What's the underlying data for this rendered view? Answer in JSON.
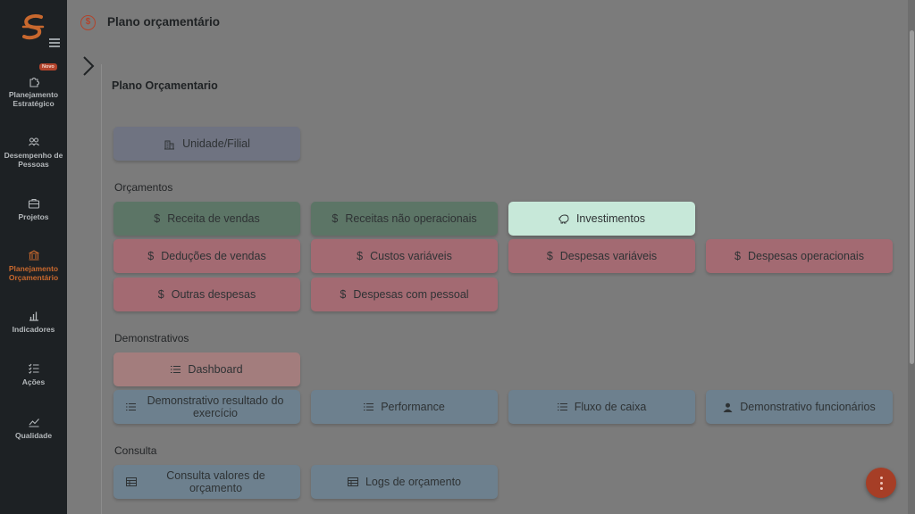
{
  "sidebar": {
    "badge": "Novo",
    "items": [
      {
        "label": "Planejamento Estratégico",
        "icon": "puzzle-icon"
      },
      {
        "label": "Desempenho de Pessoas",
        "icon": "people-icon"
      },
      {
        "label": "Projetos",
        "icon": "briefcase-icon"
      },
      {
        "label": "Planejamento Orçamentário",
        "icon": "bank-icon",
        "active": true
      },
      {
        "label": "Indicadores",
        "icon": "bar-chart-icon"
      },
      {
        "label": "Ações",
        "icon": "checklist-icon"
      },
      {
        "label": "Qualidade",
        "icon": "line-chart-icon"
      }
    ]
  },
  "header": {
    "title": "Plano orçamentário"
  },
  "main": {
    "title": "Plano Orçamentario",
    "unit_button": "Unidade/Filial",
    "groups": {
      "orcamentos": "Orçamentos",
      "demonstrativos": "Demonstrativos",
      "consulta": "Consulta"
    },
    "orcamentos": [
      "Receita de vendas",
      "Receitas não operacionais",
      "Investimentos",
      "Deduções de vendas",
      "Custos variáveis",
      "Despesas variáveis",
      "Despesas operacionais",
      "Outras despesas",
      "Despesas com pessoal"
    ],
    "demonstrativos": [
      "Dashboard",
      "Demonstrativo resultado do exercício",
      "Performance",
      "Fluxo de caixa",
      "Demonstrativo funcionários"
    ],
    "consulta": [
      "Consulta valores de orçamento",
      "Logs de orçamento"
    ]
  },
  "colors": {
    "accent": "#c8682e",
    "sidebar_bg": "#1d2124",
    "overlay_bg": "#7b7b7b",
    "investimentos_bg": "#c7e8d9"
  }
}
